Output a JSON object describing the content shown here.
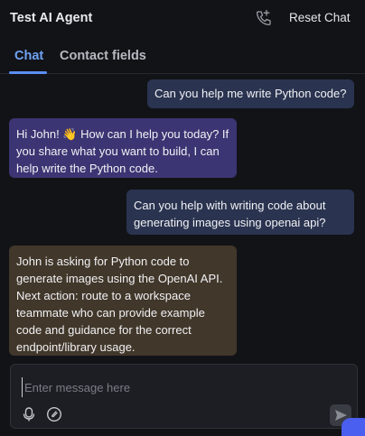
{
  "header": {
    "title": "Test AI Agent",
    "reset_label": "Reset Chat"
  },
  "tabs": [
    {
      "label": "Chat",
      "active": true
    },
    {
      "label": "Contact fields",
      "active": false
    }
  ],
  "messages": [
    {
      "role": "user",
      "text": "Can you help me write Python code?"
    },
    {
      "role": "agent",
      "text": "Hi John! 👋 How can I help you today? If you share what you want to build, I can help write the Python code."
    },
    {
      "role": "user",
      "text": "Can you help with writing code about generating images using openai api?"
    },
    {
      "role": "note",
      "text": "John is asking for Python code to generate images using the OpenAI API. Next action: route to a workspace teammate who can provide example code and guidance for the correct endpoint/library usage."
    }
  ],
  "composer": {
    "placeholder": "Enter message here"
  },
  "icons": {
    "call": "phone-call-icon",
    "voice": "microphone-icon",
    "attach": "attachment-icon",
    "send": "send-icon"
  },
  "colors": {
    "background": "#121317",
    "accent": "#5b8ff0",
    "user_bubble": "#2a3450",
    "agent_bubble": "#3b3573",
    "note_bubble": "#41372a"
  }
}
